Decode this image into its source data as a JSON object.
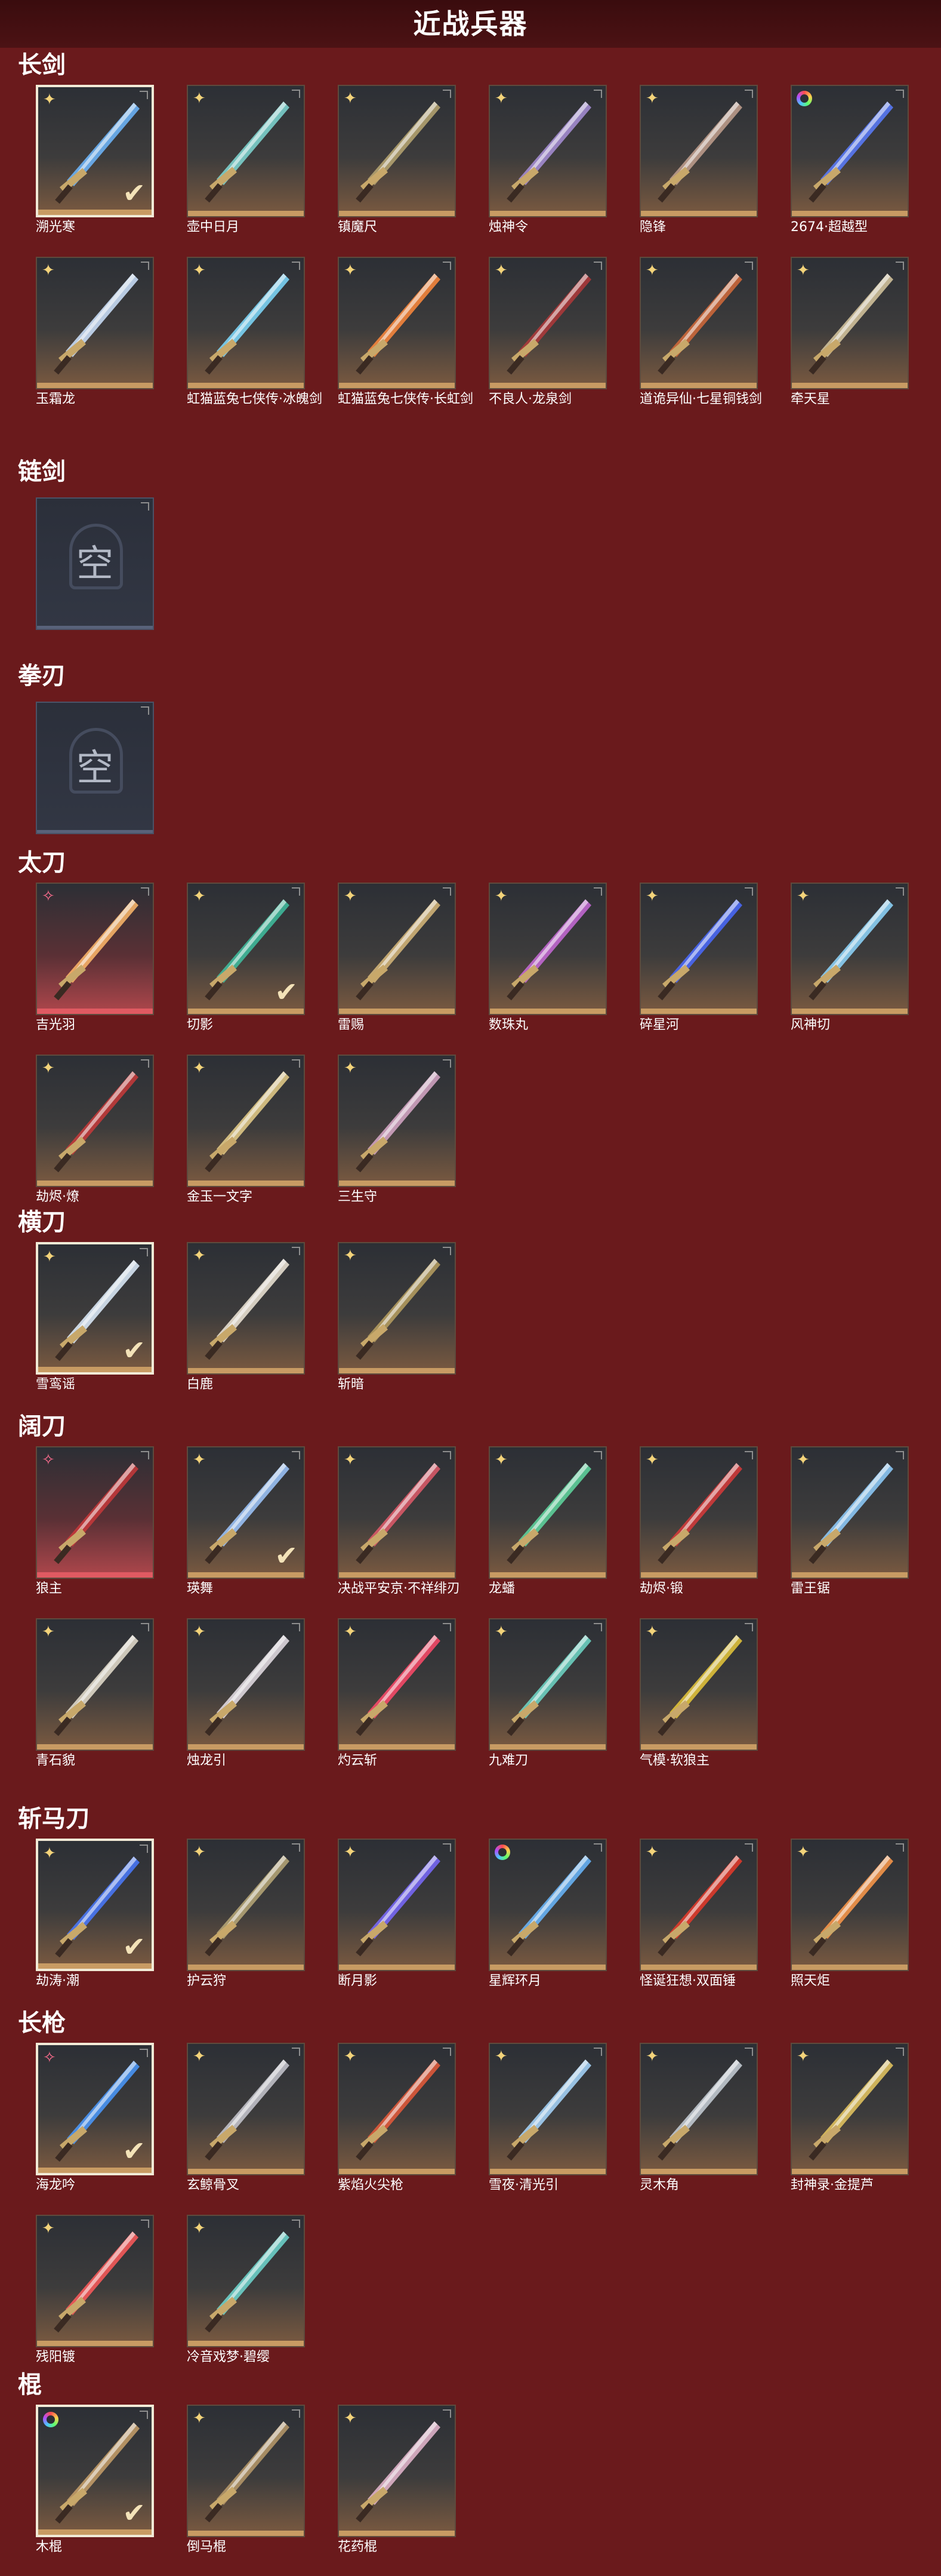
{
  "page_title": "近战兵器",
  "categories": [
    {
      "label": "长剑",
      "items": [
        {
          "name": "溯光寒",
          "rarity": "gold",
          "selected": true,
          "checked": true,
          "color": "#6fb8ff"
        },
        {
          "name": "壶中日月",
          "rarity": "gold",
          "selected": false,
          "checked": false,
          "color": "#7fd8d4"
        },
        {
          "name": "镇魔尺",
          "rarity": "gold",
          "selected": false,
          "checked": false,
          "color": "#b8a772"
        },
        {
          "name": "烛神令",
          "rarity": "gold",
          "selected": false,
          "checked": false,
          "color": "#a88fd8"
        },
        {
          "name": "隐锋",
          "rarity": "gold",
          "selected": false,
          "checked": false,
          "color": "#c2a08e"
        },
        {
          "name": "2674·超越型",
          "rarity": "rainbow",
          "selected": false,
          "checked": false,
          "color": "#5a7cff"
        },
        {
          "name": "玉霜龙",
          "rarity": "gold",
          "selected": false,
          "checked": false,
          "color": "#cfe4ff"
        },
        {
          "name": "虹猫蓝兔七侠传·冰魄剑",
          "rarity": "gold",
          "selected": false,
          "checked": false,
          "color": "#7fdcff"
        },
        {
          "name": "虹猫蓝兔七侠传·长虹剑",
          "rarity": "gold",
          "selected": false,
          "checked": false,
          "color": "#ff8a3c"
        },
        {
          "name": "不良人·龙泉剑",
          "rarity": "gold",
          "selected": false,
          "checked": false,
          "color": "#b0383a"
        },
        {
          "name": "道诡异仙·七星铜钱剑",
          "rarity": "gold",
          "selected": false,
          "checked": false,
          "color": "#d46a3a"
        },
        {
          "name": "牵天星",
          "rarity": "gold",
          "selected": false,
          "checked": false,
          "color": "#d8c8a0"
        }
      ]
    },
    {
      "label": "链剑",
      "empty_text": "空",
      "items": []
    },
    {
      "label": "拳刃",
      "empty_text": "空",
      "items": []
    },
    {
      "label": "太刀",
      "items": [
        {
          "name": "吉光羽",
          "rarity": "pink",
          "selected": false,
          "checked": false,
          "red": true,
          "color": "#ffb86a"
        },
        {
          "name": "切影",
          "rarity": "gold",
          "selected": false,
          "checked": true,
          "color": "#3fbfa0"
        },
        {
          "name": "雷赐",
          "rarity": "gold",
          "selected": false,
          "checked": false,
          "color": "#d8b87a"
        },
        {
          "name": "数珠丸",
          "rarity": "gold",
          "selected": false,
          "checked": false,
          "color": "#c86ad8"
        },
        {
          "name": "碎星河",
          "rarity": "gold",
          "selected": false,
          "checked": false,
          "color": "#4a6aff"
        },
        {
          "name": "风神切",
          "rarity": "gold",
          "selected": false,
          "checked": false,
          "color": "#8fd8ff"
        },
        {
          "name": "劫烬·燎",
          "rarity": "gold",
          "selected": false,
          "checked": false,
          "color": "#c83a3a"
        },
        {
          "name": "金玉一文字",
          "rarity": "gold",
          "selected": false,
          "checked": false,
          "color": "#e8cf8a"
        },
        {
          "name": "三生守",
          "rarity": "gold",
          "selected": false,
          "checked": false,
          "color": "#d8a8c8"
        }
      ]
    },
    {
      "label": "横刀",
      "items": [
        {
          "name": "雪鸾谣",
          "rarity": "gold",
          "selected": true,
          "checked": true,
          "color": "#e0f0ff"
        },
        {
          "name": "白鹿",
          "rarity": "gold",
          "selected": false,
          "checked": false,
          "color": "#f0e8d8"
        },
        {
          "name": "斩暗",
          "rarity": "gold",
          "selected": false,
          "checked": false,
          "color": "#b8a060"
        }
      ]
    },
    {
      "label": "阔刀",
      "items": [
        {
          "name": "狼主",
          "rarity": "pink",
          "selected": false,
          "checked": false,
          "red": true,
          "color": "#c8383a"
        },
        {
          "name": "瑛舞",
          "rarity": "gold",
          "selected": false,
          "checked": true,
          "color": "#9fc8ff"
        },
        {
          "name": "决战平安京·不祥绯刃",
          "rarity": "gold",
          "selected": false,
          "checked": false,
          "color": "#e05a6a"
        },
        {
          "name": "龙蟠",
          "rarity": "gold",
          "selected": false,
          "checked": false,
          "color": "#5fd8a0"
        },
        {
          "name": "劫烬·锻",
          "rarity": "gold",
          "selected": false,
          "checked": false,
          "color": "#d83a3a"
        },
        {
          "name": "雷王锯",
          "rarity": "gold",
          "selected": false,
          "checked": false,
          "color": "#8fcfff"
        },
        {
          "name": "青石貌",
          "rarity": "gold",
          "selected": false,
          "checked": false,
          "color": "#e8e0d0"
        },
        {
          "name": "烛龙引",
          "rarity": "gold",
          "selected": false,
          "checked": false,
          "color": "#e8e0e8"
        },
        {
          "name": "灼云斩",
          "rarity": "gold",
          "selected": false,
          "checked": false,
          "color": "#ff4a6a"
        },
        {
          "name": "九难刀",
          "rarity": "gold",
          "selected": false,
          "checked": false,
          "color": "#6fd8c8"
        },
        {
          "name": "气模·软狼主",
          "rarity": "gold",
          "selected": false,
          "checked": false,
          "color": "#e8c83a"
        }
      ]
    },
    {
      "label": "斩马刀",
      "items": [
        {
          "name": "劫涛·潮",
          "rarity": "gold",
          "selected": true,
          "checked": true,
          "color": "#4a7aff"
        },
        {
          "name": "护云狩",
          "rarity": "gold",
          "selected": false,
          "checked": false,
          "color": "#b8a878"
        },
        {
          "name": "断月影",
          "rarity": "gold",
          "selected": false,
          "checked": false,
          "color": "#7a6aff"
        },
        {
          "name": "星辉环月",
          "rarity": "rainbow",
          "selected": false,
          "checked": false,
          "color": "#6ab8ff"
        },
        {
          "name": "怪诞狂想·双面锤",
          "rarity": "gold",
          "selected": false,
          "checked": false,
          "color": "#e83a2a"
        },
        {
          "name": "照天炬",
          "rarity": "gold",
          "selected": false,
          "checked": false,
          "color": "#ff9a4a"
        }
      ]
    },
    {
      "label": "长枪",
      "items": [
        {
          "name": "海龙吟",
          "rarity": "pink",
          "selected": true,
          "checked": true,
          "color": "#4a9aff"
        },
        {
          "name": "玄鲸骨叉",
          "rarity": "gold",
          "selected": false,
          "checked": false,
          "color": "#c8c8d0"
        },
        {
          "name": "紫焰火尖枪",
          "rarity": "gold",
          "selected": false,
          "checked": false,
          "color": "#e85a3a"
        },
        {
          "name": "雪夜·清光引",
          "rarity": "gold",
          "selected": false,
          "checked": false,
          "color": "#a8d8ff"
        },
        {
          "name": "灵木角",
          "rarity": "gold",
          "selected": false,
          "checked": false,
          "color": "#c8d0d8"
        },
        {
          "name": "封神录·金提芦",
          "rarity": "gold",
          "selected": false,
          "checked": false,
          "color": "#e8c860"
        },
        {
          "name": "残阳镀",
          "rarity": "gold",
          "selected": false,
          "checked": false,
          "color": "#ff5a5a"
        },
        {
          "name": "冷音戏梦·碧缨",
          "rarity": "gold",
          "selected": false,
          "checked": false,
          "color": "#6fd8d0"
        }
      ]
    },
    {
      "label": "棍",
      "items": [
        {
          "name": "木棍",
          "rarity": "rainbow",
          "selected": true,
          "checked": true,
          "color": "#c8a06a"
        },
        {
          "name": "倒马棍",
          "rarity": "gold",
          "selected": false,
          "checked": false,
          "color": "#b89a6a"
        },
        {
          "name": "花药棍",
          "rarity": "gold",
          "selected": false,
          "checked": false,
          "color": "#e8b8d0"
        }
      ]
    }
  ]
}
